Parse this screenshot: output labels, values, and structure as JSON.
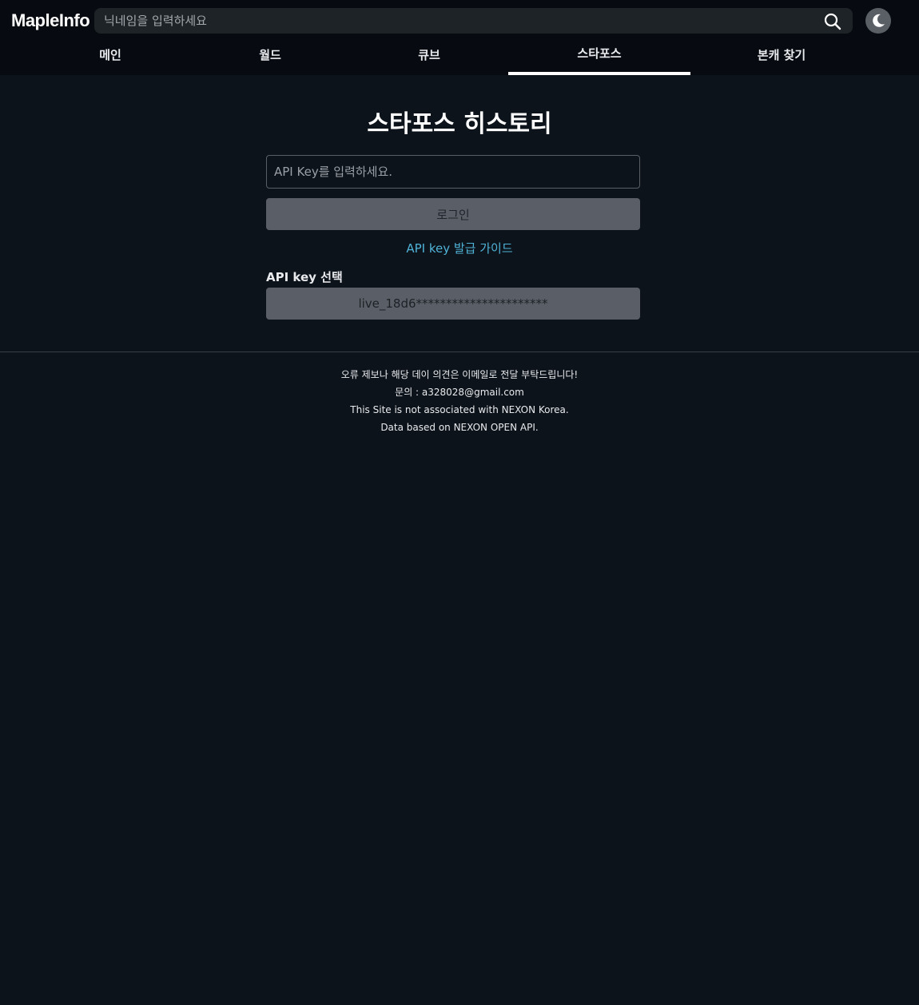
{
  "header": {
    "logo": "MapleInfo",
    "search_placeholder": "닉네임을 입력하세요"
  },
  "nav": {
    "tabs": [
      {
        "label": "메인"
      },
      {
        "label": "월드"
      },
      {
        "label": "큐브"
      },
      {
        "label": "스타포스"
      },
      {
        "label": "본캐 찾기"
      }
    ],
    "active_tab": "스타포스"
  },
  "main": {
    "title": "스타포스 히스토리",
    "api_input_placeholder": "API Key를 입력하세요.",
    "login_label": "로그인",
    "guide_link": "API key 발급 가이드",
    "select_label": "API key 선택",
    "selected_key": "live_18d6**********************"
  },
  "footer": {
    "lines": [
      "오류 제보나 해당 데이 의견은 이메일로 전달 부탁드립니다!",
      "문의 : a328028@gmail.com",
      "This Site is not associated with NEXON Korea.",
      "Data based on NEXON OPEN API."
    ]
  },
  "colors": {
    "background": "#0d131b",
    "header": "#070b11",
    "accent_link": "#4fb3d8",
    "button": "#5a5f67"
  }
}
